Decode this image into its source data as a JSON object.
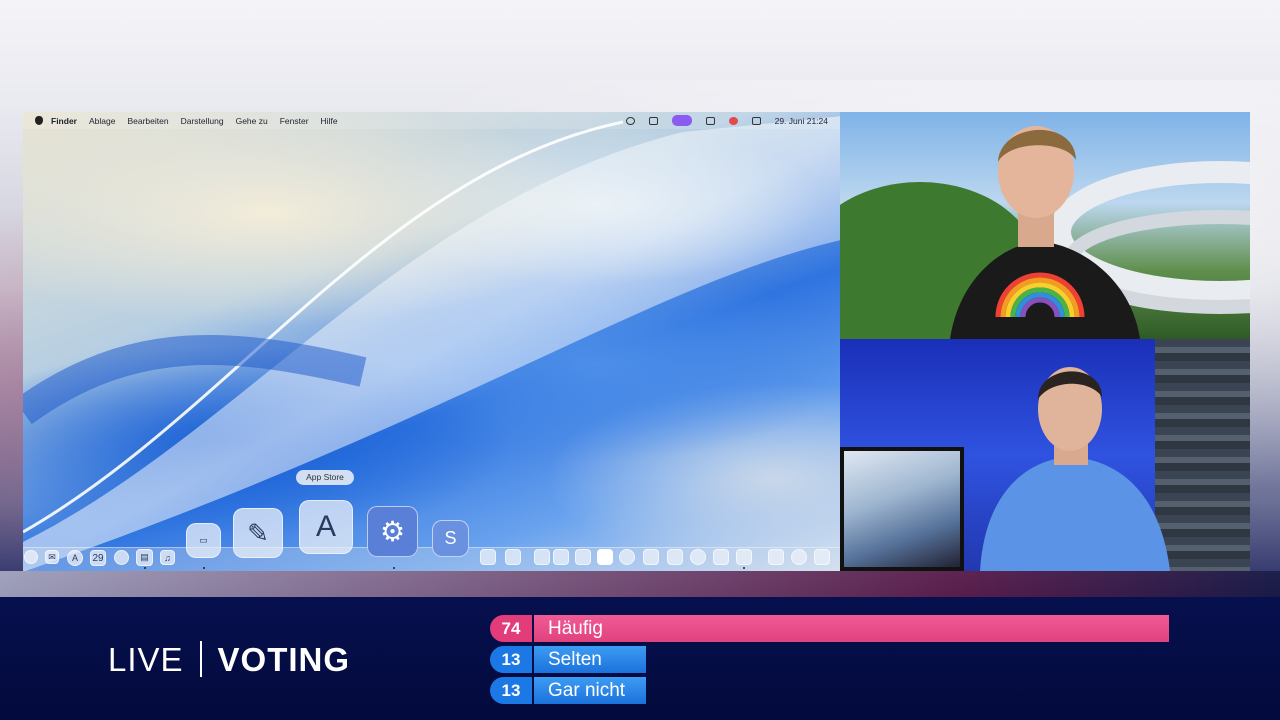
{
  "mac": {
    "menubar": {
      "app": "Finder",
      "menus": [
        "Ablage",
        "Bearbeiten",
        "Darstellung",
        "Gehe zu",
        "Fenster",
        "Hilfe"
      ],
      "datetime": "29. Juni  21:24"
    },
    "dock": {
      "tooltip": "App Store",
      "calendar_day": "29",
      "icons": [
        "Finder",
        "Mail",
        "Xcode",
        "Calendar",
        "Contacts",
        "Mission Control",
        "Music",
        "Keynote",
        "Pages",
        "App Store",
        "System Settings",
        "Skype"
      ]
    }
  },
  "lower_third": {
    "live": "LIVE",
    "title": "VOTING"
  },
  "voting": [
    {
      "count": "74",
      "label": "Häufig",
      "percent": 74,
      "color": "#e23c7a"
    },
    {
      "count": "13",
      "label": "Selten",
      "percent": 13,
      "color": "#1b78e4"
    },
    {
      "count": "13",
      "label": "Gar nicht",
      "percent": 13,
      "color": "#1b78e4"
    }
  ]
}
